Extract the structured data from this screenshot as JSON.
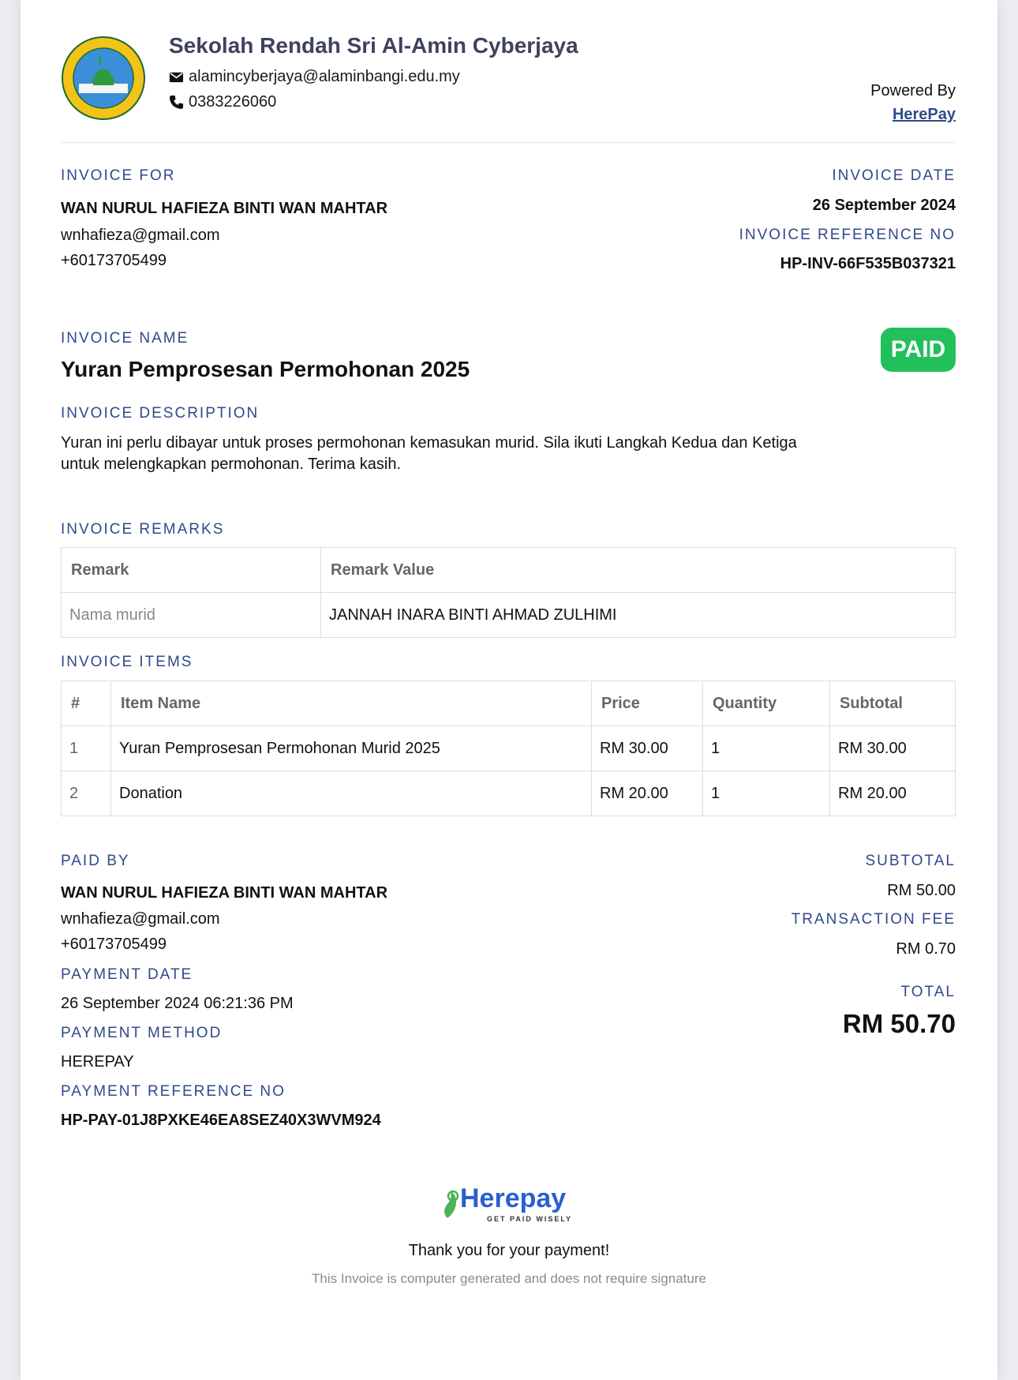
{
  "header": {
    "school_name": "Sekolah Rendah Sri Al-Amin Cyberjaya",
    "email": "alamincyberjaya@alaminbangi.edu.my",
    "phone": "0383226060",
    "powered_by_label": "Powered By",
    "powered_by_link": "HerePay"
  },
  "invoice_for": {
    "label": "INVOICE FOR",
    "name": "WAN NURUL HAFIEZA BINTI WAN MAHTAR",
    "email": "wnhafieza@gmail.com",
    "phone": "+60173705499"
  },
  "invoice_date": {
    "label": "INVOICE DATE",
    "value": "26 September 2024"
  },
  "invoice_ref": {
    "label": "INVOICE REFERENCE NO",
    "value": "HP-INV-66F535B037321"
  },
  "invoice_name": {
    "label": "INVOICE NAME",
    "value": "Yuran Pemprosesan Permohonan 2025"
  },
  "status_badge": {
    "text": "PAID",
    "color": "#22c05a"
  },
  "invoice_description": {
    "label": "INVOICE DESCRIPTION",
    "line1": "Yuran ini perlu dibayar untuk proses permohonan kemasukan murid. Sila ikuti Langkah Kedua dan Ketiga",
    "line2": "untuk melengkapkan permohonan. Terima kasih."
  },
  "remarks": {
    "label": "INVOICE REMARKS",
    "headers": [
      "Remark",
      "Remark Value"
    ],
    "rows": [
      [
        "Nama murid",
        "JANNAH INARA BINTI AHMAD ZULHIMI"
      ]
    ]
  },
  "items": {
    "label": "INVOICE ITEMS",
    "headers": [
      "#",
      "Item Name",
      "Price",
      "Quantity",
      "Subtotal"
    ],
    "rows": [
      [
        "1",
        "Yuran Pemprosesan Permohonan Murid 2025",
        "RM 30.00",
        "1",
        "RM 30.00"
      ],
      [
        "2",
        "Donation",
        "RM 20.00",
        "1",
        "RM 20.00"
      ]
    ]
  },
  "paid_by": {
    "label": "PAID BY",
    "name": "WAN NURUL HAFIEZA BINTI WAN MAHTAR",
    "email": "wnhafieza@gmail.com",
    "phone": "+60173705499"
  },
  "payment_date": {
    "label": "PAYMENT DATE",
    "value": "26 September 2024 06:21:36 PM"
  },
  "payment_method": {
    "label": "PAYMENT METHOD",
    "value": "HEREPAY"
  },
  "payment_ref": {
    "label": "PAYMENT REFERENCE NO",
    "value": "HP-PAY-01J8PXKE46EA8SEZ40X3WVM924"
  },
  "totals": {
    "subtotal_label": "SUBTOTAL",
    "subtotal": "RM 50.00",
    "fee_label": "TRANSACTION FEE",
    "fee": "RM 0.70",
    "total_label": "TOTAL",
    "total": "RM 50.70"
  },
  "footer": {
    "logo_text": "Herepay",
    "logo_tagline": "GET PAID WISELY",
    "thanks": "Thank you for your payment!",
    "note": "This Invoice is computer generated and does not require signature"
  },
  "colors": {
    "accent": "#2f4a8a",
    "paid": "#22c05a"
  }
}
